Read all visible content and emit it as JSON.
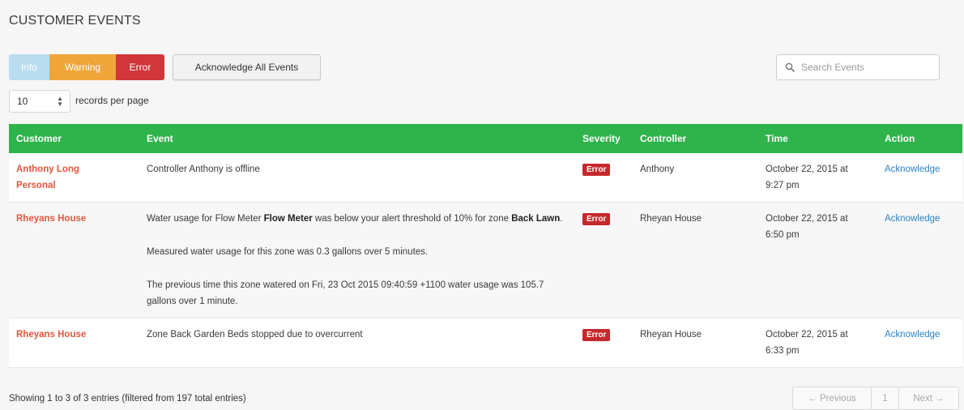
{
  "page": {
    "title": "CUSTOMER EVENTS"
  },
  "toolbar": {
    "filters": {
      "info": "Info",
      "warning": "Warning",
      "error": "Error"
    },
    "ack_all": "Acknowledge All Events",
    "search_placeholder": "Search Events"
  },
  "length": {
    "value": "10",
    "label": "records per page"
  },
  "table": {
    "headers": {
      "customer": "Customer",
      "event": "Event",
      "severity": "Severity",
      "controller": "Controller",
      "time": "Time",
      "action": "Action"
    },
    "rows": [
      {
        "customer_line1": "Anthony Long",
        "customer_line2": "Personal",
        "event_text": "Controller Anthony is offline",
        "severity": "Error",
        "controller": "Anthony",
        "time_line1": "October 22, 2015 at",
        "time_line2": "9:27 pm",
        "action": "Acknowledge"
      },
      {
        "customer_line1": "Rheyans House",
        "event_p1_a": "Water usage for Flow Meter ",
        "event_p1_b": "Flow Meter",
        "event_p1_c": " was below your alert threshold of 10% for zone ",
        "event_p1_d": "Back Lawn",
        "event_p1_e": ".",
        "event_p2": "Measured water usage for this zone was 0.3 gallons over 5 minutes.",
        "event_p3": "The previous time this zone watered on Fri, 23 Oct 2015 09:40:59 +1100 water usage was 105.7 gallons over 1 minute.",
        "severity": "Error",
        "controller": "Rheyan House",
        "time_line1": "October 22, 2015 at",
        "time_line2": "6:50 pm",
        "action": "Acknowledge"
      },
      {
        "customer_line1": "Rheyans House",
        "event_text": "Zone Back Garden Beds stopped due to overcurrent",
        "severity": "Error",
        "controller": "Rheyan House",
        "time_line1": "October 22, 2015 at",
        "time_line2": "6:33 pm",
        "action": "Acknowledge"
      }
    ]
  },
  "footer": {
    "info": "Showing 1 to 3 of 3 entries (filtered from 197 total entries)",
    "prev": "← Previous",
    "page": "1",
    "next": "Next →"
  },
  "colors": {
    "header_green": "#2fb34b",
    "info": "#b9dcef",
    "warning": "#f0a539",
    "error": "#d0363a",
    "customer_link": "#e2573e",
    "action_link": "#2a83c6"
  }
}
